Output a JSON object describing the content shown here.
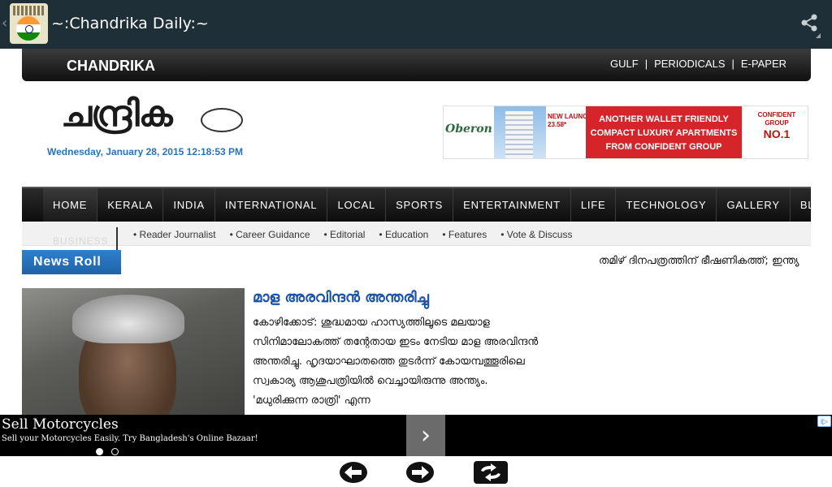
{
  "app": {
    "title": "~:Chandrika Daily:~",
    "back_icon": "‹",
    "share_icon": "share-icon"
  },
  "topbar": {
    "brand": "CHANDRIKA",
    "links": [
      "GULF",
      "PERIODICALS",
      "E-PAPER"
    ]
  },
  "masthead": {
    "logo_text": "ചന്ദ്രിക",
    "datetime": "Wednesday, January 28, 2015 12:18:53 PM"
  },
  "banner_ad": {
    "brand": "Oberon",
    "launch": "NEW LAUNCH",
    "price": "23.58*",
    "headline": [
      "ANOTHER WALLET FRIENDLY",
      "COMPACT LUXURY APARTMENTS",
      "FROM CONFIDENT GROUP"
    ],
    "right_brand": "CONFIDENT GROUP",
    "right_tag": "NO.1"
  },
  "nav": {
    "items": [
      "HOME",
      "KERALA",
      "INDIA",
      "INTERNATIONAL",
      "LOCAL",
      "SPORTS",
      "ENTERTAINMENT",
      "LIFE",
      "TECHNOLOGY",
      "GALLERY",
      "BLOGS"
    ],
    "overflow_item": "BUSINESS",
    "sub_items": [
      "• Reader Journalist",
      "• Career Guidance",
      "• Editorial",
      "• Education",
      "• Features",
      "• Vote & Discuss"
    ]
  },
  "newsroll": {
    "label": "News Roll",
    "ticker": "തമിഴ് ദിനപത്രത്തിന് ഭീഷണികത്ത്; ഇന്ത്യ"
  },
  "article": {
    "title": "മാള അരവിന്ദൻ അന്തരിച്ചു",
    "body": "കോഴിക്കോട്: ശുദ്ധമായ ഹാസ്യത്തിലൂടെ മലയാള സിനിമാലോകത്ത് തന്റേതായ ഇടം നേടിയ മാള അരവിന്ദൻ അന്തരിച്ചു. ഹൃദയാഘാതത്തെ തുടർന്ന് കോയമ്പത്തൂരിലെ സ്വകാര്യ ആശുപത്രിയിൽ വെച്ചായിരുന്നു അന്ത്യം. 'മധുരിക്കുന്ന രാത്രി' എന്ന"
  },
  "bottom_ad": {
    "title": "Sell Motorcycles",
    "text": "Sell your Motorcycles Easily. Try Bangladesh's Online Bazaar!",
    "next_glyph": "›",
    "info_glyph": "i▷"
  },
  "colors": {
    "actionbar": "#1f2f38",
    "accent_blue": "#1a53a8",
    "newsroll": "#2f7fcf",
    "ad_red": "#d6242b"
  }
}
